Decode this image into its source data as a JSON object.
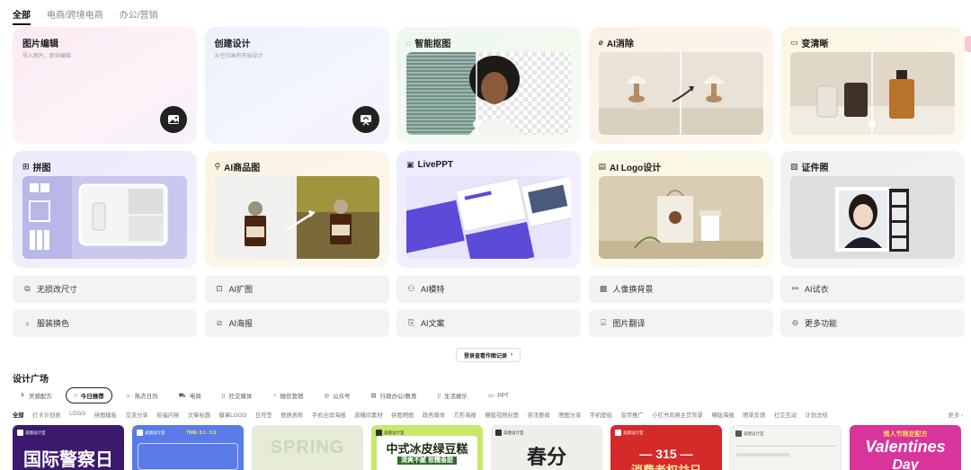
{
  "tabs": [
    "全部",
    "电商/跨境电商",
    "办公/营销"
  ],
  "cards": {
    "image_edit": {
      "title": "图片编辑",
      "sub": "导入图片，即刻编辑"
    },
    "create_design": {
      "title": "创建设计",
      "sub": "从空白画布开始设计"
    },
    "smart_cutout": {
      "title": "智能抠图"
    },
    "ai_erase": {
      "title": "AI消除"
    },
    "upscale": {
      "title": "变清晰"
    },
    "collage": {
      "title": "拼图"
    },
    "ai_product": {
      "title": "AI商品图"
    },
    "liveppt": {
      "title": "LivePPT"
    },
    "ai_logo": {
      "title": "AI Logo设计"
    },
    "id_photo": {
      "title": "证件照"
    }
  },
  "quick_tools": [
    "无损改尺寸",
    "AI扩图",
    "AI模特",
    "人像换背景",
    "AI试衣",
    "服装换色",
    "AI海报",
    "AI文案",
    "图片翻译",
    "更多功能"
  ],
  "login_link": "登录查看作图记录",
  "plaza_title": "设计广场",
  "chips": [
    "灵感配方",
    "今日推荐",
    "热点日历",
    "电商",
    "社交媒体",
    "微信营销",
    "公众号",
    "行政办公/教育",
    "生活娱乐",
    "PPT"
  ],
  "categories": [
    "全部",
    "打卡计划表",
    "LOGO",
    "拼图模板",
    "交流分享",
    "祝福问候",
    "文章标题",
    "徽章LOGO",
    "日月签",
    "数据表彰",
    "手机全屏海报",
    "直播间素材",
    "拼图晒图",
    "政务媒体",
    "方形海报",
    "横版视频封面",
    "资讯要闻",
    "晒图分享",
    "手机壁纸",
    "宣传推广",
    "小红书风格主页背景",
    "横版海报",
    "晒单反馈",
    "社交互动",
    "计划总结"
  ],
  "more_label": "更多",
  "templates": [
    {
      "badge": "美图设计室",
      "text": "国际警察日"
    },
    {
      "badge": "美图设计室",
      "text": "TIME: 5.1 - 5.5"
    },
    {
      "badge": "",
      "text": "SPRING"
    },
    {
      "badge": "美图设计室",
      "text": "中式冰皮绿豆糕",
      "sub": "清爽不腻 软糯香甜"
    },
    {
      "badge": "美图设计室",
      "text": "春分"
    },
    {
      "badge": "美图设计室",
      "text": "— 315 —",
      "sub": "消费者权益日"
    },
    {
      "badge": "美图设计室",
      "text": ""
    },
    {
      "badge": "",
      "text": "Valentines",
      "sub": "Day",
      "top": "情人节限定配方"
    }
  ],
  "colors": {
    "tpl1": "#3b1a6e",
    "tpl2": "#5b7be8",
    "tpl3": "#e6ecd8",
    "tpl4": "#c7e86a",
    "tpl5": "#efeee9",
    "tpl6": "#d52a2a",
    "tpl7": "#f3f3f0",
    "tpl8": "#d8349c"
  }
}
